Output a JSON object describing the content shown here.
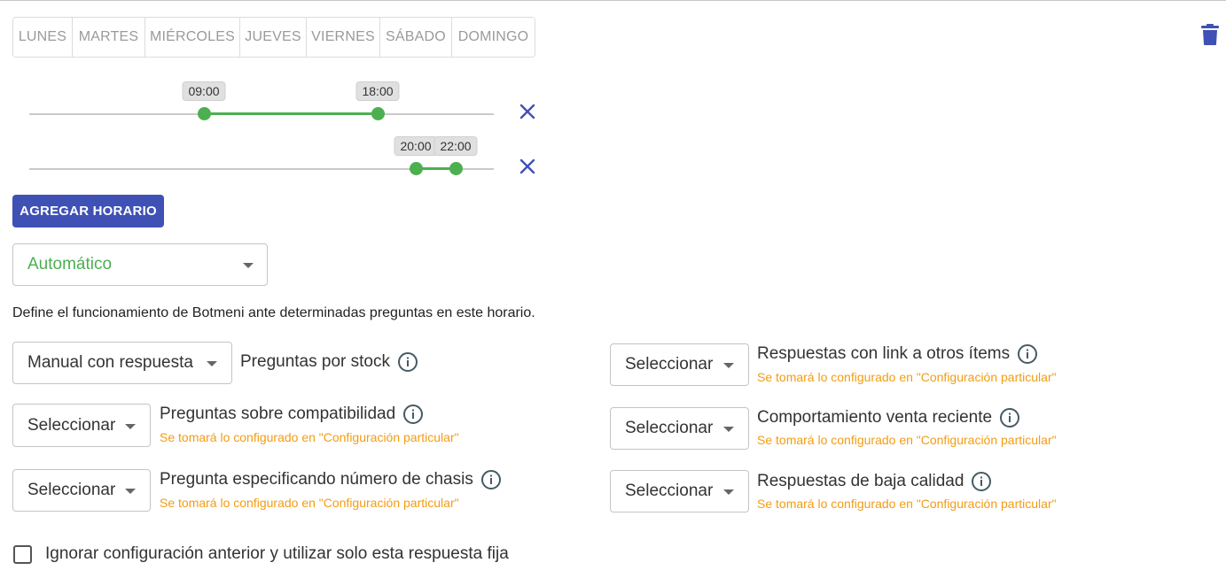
{
  "days": [
    {
      "label": "LUNES",
      "active": true
    },
    {
      "label": "MARTES",
      "active": false
    },
    {
      "label": "MIÉRCOLES",
      "active": true
    },
    {
      "label": "JUEVES",
      "active": false
    },
    {
      "label": "VIERNES",
      "active": false
    },
    {
      "label": "SÁBADO",
      "active": false
    },
    {
      "label": "DOMINGO",
      "active": false
    }
  ],
  "schedules": [
    {
      "start": "09:00",
      "end": "18:00",
      "start_fraction": 0.375,
      "end_fraction": 0.75
    },
    {
      "start": "20:00",
      "end": "22:00",
      "start_fraction": 0.833,
      "end_fraction": 0.917
    }
  ],
  "add_button": "AGREGAR HORARIO",
  "mode": {
    "value": "Automático"
  },
  "description": "Define el funcionamiento de Botmeni ante determinadas preguntas en este horario.",
  "rules_left": [
    {
      "select": "Manual con respuesta",
      "label": "Preguntas por stock",
      "note": ""
    },
    {
      "select": "Seleccionar",
      "label": "Preguntas sobre compatibilidad",
      "note": "Se tomará lo configurado en \"Configuración particular\""
    },
    {
      "select": "Seleccionar",
      "label": "Pregunta especificando número de chasis",
      "note": "Se tomará lo configurado en \"Configuración particular\""
    }
  ],
  "rules_right": [
    {
      "select": "Seleccionar",
      "label": "Respuestas con link a otros ítems",
      "note": "Se tomará lo configurado en \"Configuración particular\""
    },
    {
      "select": "Seleccionar",
      "label": "Comportamiento venta reciente",
      "note": "Se tomará lo configurado en \"Configuración particular\""
    },
    {
      "select": "Seleccionar",
      "label": "Respuestas de baja calidad",
      "note": "Se tomará lo configurado en \"Configuración particular\""
    }
  ],
  "checkbox": {
    "label": "Ignorar configuración anterior y utilizar solo esta respuesta fija",
    "checked": false
  },
  "colors": {
    "primary": "#3f51b5",
    "accent_green": "#4caf50",
    "note_orange": "#f39c12"
  },
  "icons": {
    "delete": "trash-icon",
    "remove": "close-icon",
    "info": "info-icon",
    "dropdown": "caret-down-icon"
  }
}
